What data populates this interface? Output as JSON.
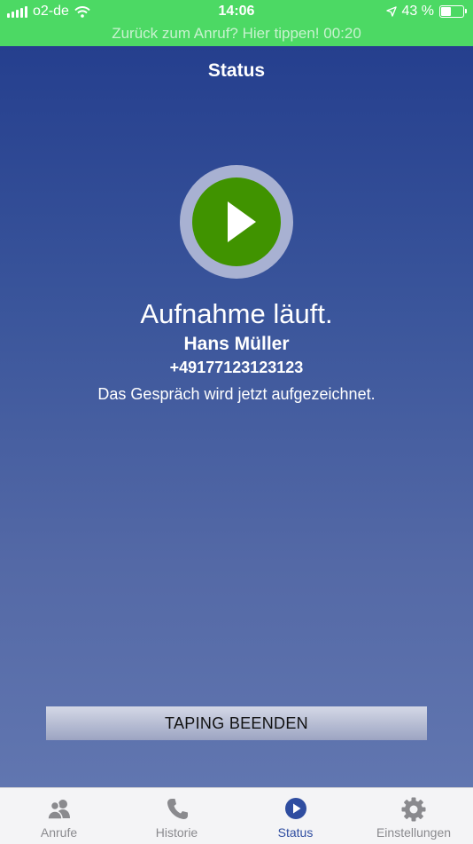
{
  "status_bar": {
    "carrier": "o2-de",
    "time": "14:06",
    "battery_percent": "43 %",
    "battery_level": 0.43,
    "return_call": "Zurück zum Anruf? Hier tippen! 00:20"
  },
  "nav": {
    "title": "Status"
  },
  "recording": {
    "headline": "Aufnahme läuft.",
    "caller_name": "Hans Müller",
    "caller_number": "+49177123123123",
    "description": "Das Gespräch wird jetzt aufgezeichnet."
  },
  "actions": {
    "stop_label": "TAPING BEENDEN"
  },
  "tabs": [
    {
      "label": "Anrufe",
      "icon": "people-icon"
    },
    {
      "label": "Historie",
      "icon": "phone-icon"
    },
    {
      "label": "Status",
      "icon": "play-circle-icon",
      "active": true
    },
    {
      "label": "Einstellungen",
      "icon": "gear-icon"
    }
  ],
  "colors": {
    "status_bar": "#4cd964",
    "background_top": "#253f8e",
    "play_button": "#409300",
    "tab_active": "#2f4da0",
    "tab_inactive": "#8a8a8e"
  }
}
